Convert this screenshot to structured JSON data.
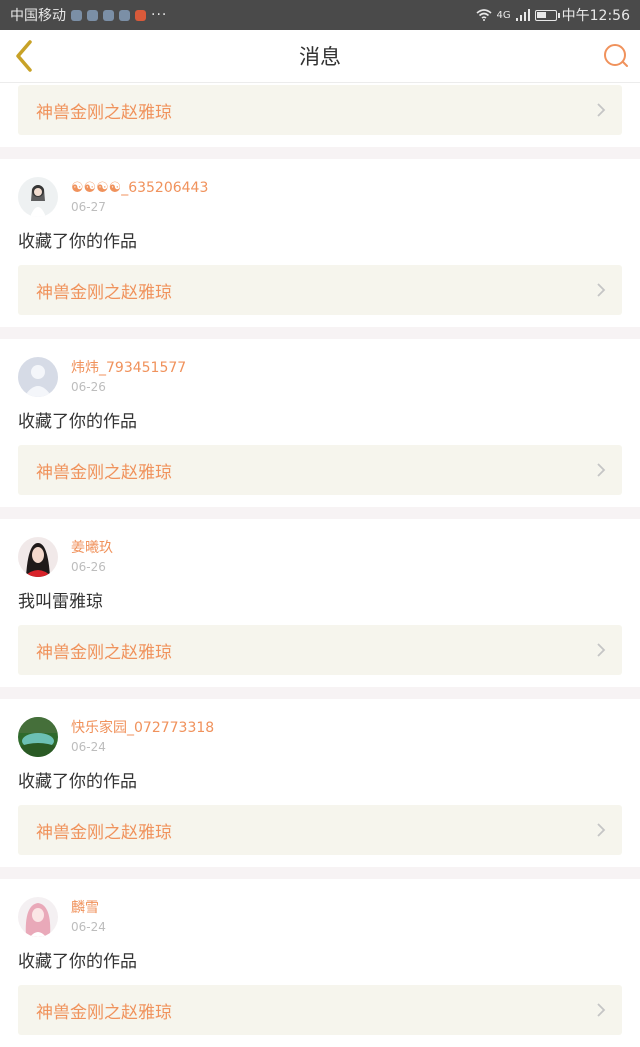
{
  "status_bar": {
    "carrier": "中国移动",
    "more": "···",
    "signal_label": "4G",
    "time": "中午12:56",
    "battery_level": 0.5
  },
  "header": {
    "title": "消息",
    "back_icon": "chevron-left-icon",
    "search_icon": "search-icon"
  },
  "top_partial": {
    "work_title": "神兽金刚之赵雅琼"
  },
  "messages": [
    {
      "username": "☯☯☯☯_635206443",
      "date": "06-27",
      "text": "收藏了你的作品",
      "work_title": "神兽金刚之赵雅琼"
    },
    {
      "username": "炜炜_793451577",
      "date": "06-26",
      "text": "收藏了你的作品",
      "work_title": "神兽金刚之赵雅琼"
    },
    {
      "username": "姜曦玖",
      "date": "06-26",
      "text": "我叫雷雅琼",
      "work_title": "神兽金刚之赵雅琼"
    },
    {
      "username": "快乐家园_072773318",
      "date": "06-24",
      "text": "收藏了你的作品",
      "work_title": "神兽金刚之赵雅琼"
    },
    {
      "username": "麟雪",
      "date": "06-24",
      "text": "收藏了你的作品",
      "work_title": "神兽金刚之赵雅琼"
    }
  ],
  "colors": {
    "accent": "#f0925c",
    "back_arrow": "#c8a227",
    "work_box_bg": "#f6f5ed"
  }
}
